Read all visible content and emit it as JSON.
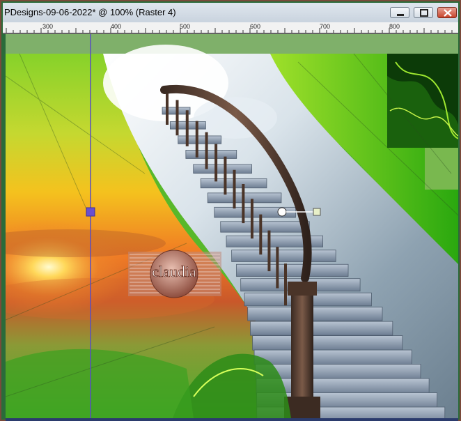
{
  "window": {
    "title": "PDesigns-09-06-2022* @ 100% (Raster 4)",
    "buttons": {
      "minimize_icon": "minimize-icon",
      "maximize_icon": "maximize-icon",
      "close_icon": "close-icon"
    }
  },
  "ruler": {
    "labels": [
      "300",
      "400",
      "500",
      "600",
      "700",
      "800"
    ]
  },
  "canvas": {
    "watermark": {
      "text": "claudia"
    }
  },
  "colors": {
    "frame_green": "#2a6b3a",
    "guide_line": "#5a4fc0",
    "handle": "#6a4fd0",
    "close_red": "#c8442c"
  }
}
